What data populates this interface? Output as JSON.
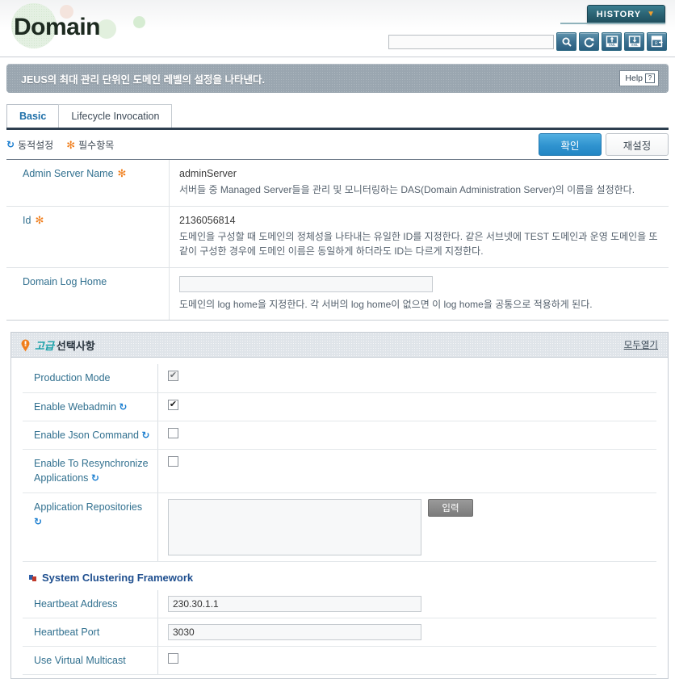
{
  "header": {
    "title": "Domain",
    "history_label": "HISTORY",
    "history_chevron": "▼",
    "search_placeholder": "",
    "search_value": "",
    "icons": [
      {
        "name": "search-icon",
        "title": "search"
      },
      {
        "name": "refresh-icon",
        "title": "refresh"
      },
      {
        "name": "xml-upload-icon",
        "title": "xml-upload"
      },
      {
        "name": "xml-download-icon",
        "title": "xml-download"
      },
      {
        "name": "save-export-icon",
        "title": "save-export"
      }
    ]
  },
  "infobar": {
    "description": "JEUS의 최대 관리 단위인 도메인 레벨의 설정을 나타낸다.",
    "help_label": "Help",
    "help_mark": "?"
  },
  "tabs": [
    {
      "label": "Basic",
      "active": true
    },
    {
      "label": "Lifecycle Invocation",
      "active": false
    }
  ],
  "legend": {
    "dynamic_icon": "↻",
    "dynamic_label": "동적설정",
    "required_icon": "✻",
    "required_label": "필수항목"
  },
  "actions": {
    "confirm_label": "확인",
    "reset_label": "재설정"
  },
  "basic_fields": [
    {
      "label": "Admin Server Name",
      "required": true,
      "dynamic": false,
      "type": "text-value",
      "value": "adminServer",
      "description": "서버들 중 Managed Server들을 관리 및 모니터링하는 DAS(Domain Administration Server)의 이름을 설정한다."
    },
    {
      "label": "Id",
      "required": true,
      "dynamic": false,
      "type": "text-value",
      "value": "2136056814",
      "description": "도메인을 구성할 때 도메인의 정체성을 나타내는 유일한 ID를 지정한다. 같은 서브넷에 TEST 도메인과 운영 도메인을 또같이 구성한 경우에 도메인 이름은 동일하게 하더라도 ID는 다르게 지정한다."
    },
    {
      "label": "Domain Log Home",
      "required": false,
      "dynamic": false,
      "type": "input",
      "value": "",
      "description": "도메인의 log home을 지정한다. 각 서버의 log home이 없으면 이 log home을 공통으로 적용하게 된다."
    }
  ],
  "advanced": {
    "title_accent": "고급",
    "title_rest": "선택사항",
    "expand_all_label": "모두열기",
    "rows": [
      {
        "label": "Production Mode",
        "dynamic": false,
        "type": "checkbox",
        "checked": true,
        "dimmed": true
      },
      {
        "label": "Enable Webadmin",
        "dynamic": true,
        "type": "checkbox",
        "checked": true,
        "dimmed": false
      },
      {
        "label": "Enable Json Command",
        "dynamic": true,
        "type": "checkbox",
        "checked": false,
        "dimmed": false
      },
      {
        "label": "Enable To Resynchronize Applications",
        "dynamic": true,
        "type": "checkbox",
        "checked": false,
        "dimmed": false
      },
      {
        "label": "Application Repositories",
        "dynamic": true,
        "type": "textarea",
        "value": "",
        "button_label": "입력"
      }
    ],
    "subsection": {
      "title": "System Clustering Framework",
      "rows": [
        {
          "label": "Heartbeat Address",
          "type": "input",
          "value": "230.30.1.1"
        },
        {
          "label": "Heartbeat Port",
          "type": "input",
          "value": "3030"
        },
        {
          "label": "Use Virtual Multicast",
          "type": "checkbox",
          "checked": false
        }
      ]
    }
  },
  "colors": {
    "accent_blue": "#31708f",
    "primary_button": "#2f93cf",
    "required_orange": "#f07d1a",
    "dynamic_blue": "#1d7fd0",
    "infobar_gray": "#9aa6b0",
    "history_teal": "#2b6374"
  }
}
